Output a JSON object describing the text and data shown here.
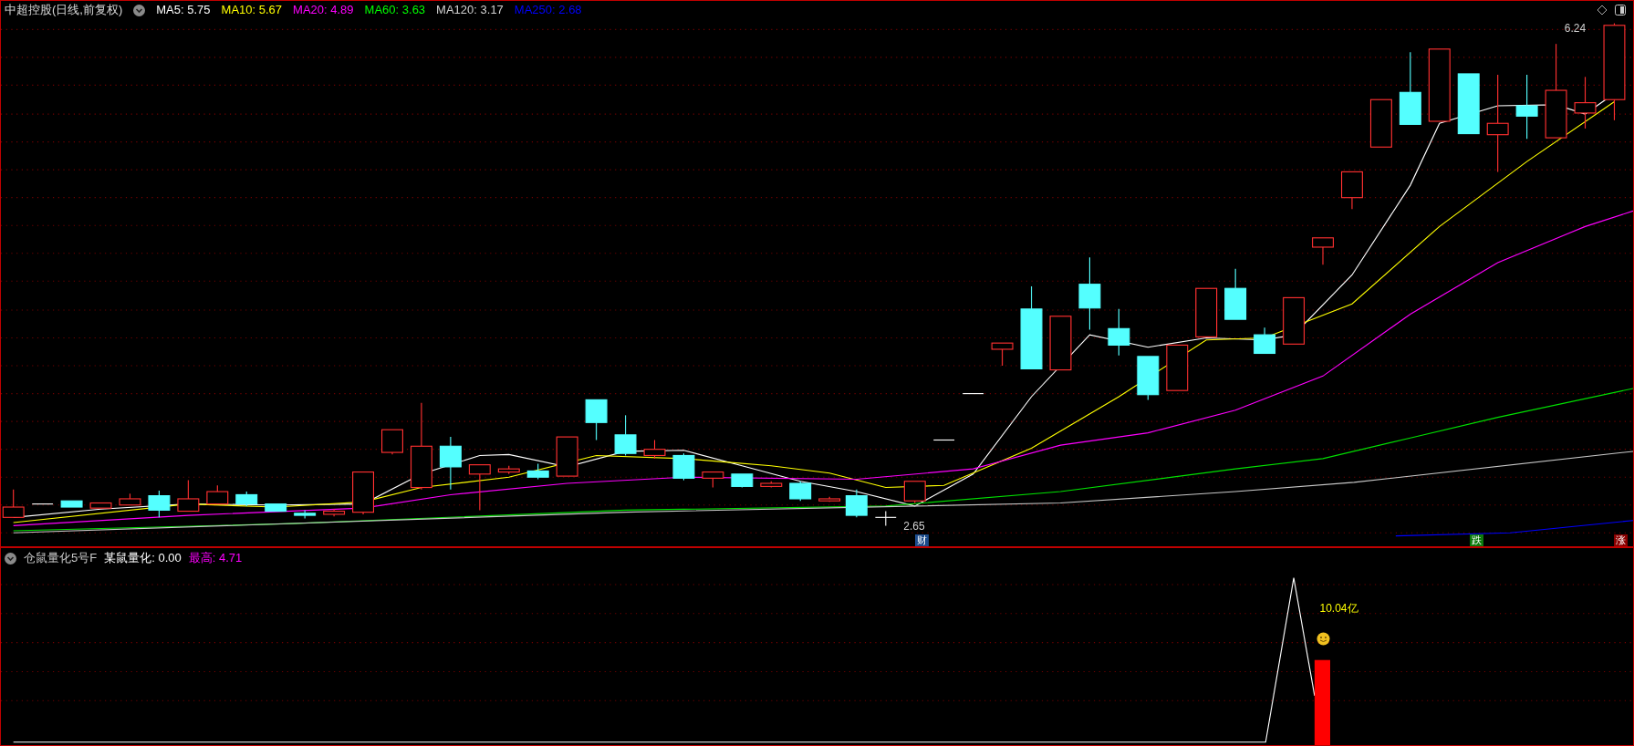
{
  "main_pane": {
    "title": "中超控股(日线,前复权)",
    "ma_items": [
      {
        "label": "MA5:",
        "value": "5.75",
        "color": "#ffffff"
      },
      {
        "label": "MA10:",
        "value": "5.67",
        "color": "#ffff00"
      },
      {
        "label": "MA20:",
        "value": "4.89",
        "color": "#ff00ff"
      },
      {
        "label": "MA60:",
        "value": "3.63",
        "color": "#00ff00"
      },
      {
        "label": "MA120:",
        "value": "3.17",
        "color": "#d0d0d0"
      },
      {
        "label": "MA250:",
        "value": "2.68",
        "color": "#0000ff"
      }
    ],
    "high_label": "6.24",
    "low_label": "2.65",
    "markers": [
      {
        "text": "财",
        "color": "#1c4a8a"
      },
      {
        "text": "跌",
        "color": "#0c7a0c"
      },
      {
        "text": "涨",
        "color": "#8b0000"
      }
    ]
  },
  "indicator_pane": {
    "title": "仓鼠量化5号F",
    "items": [
      {
        "label": "某鼠量化:",
        "value": "0.00",
        "color": "#ffffff"
      },
      {
        "label": "最高:",
        "value": "4.71",
        "color": "#ff00ff"
      }
    ],
    "annotation": "10.04亿"
  }
}
